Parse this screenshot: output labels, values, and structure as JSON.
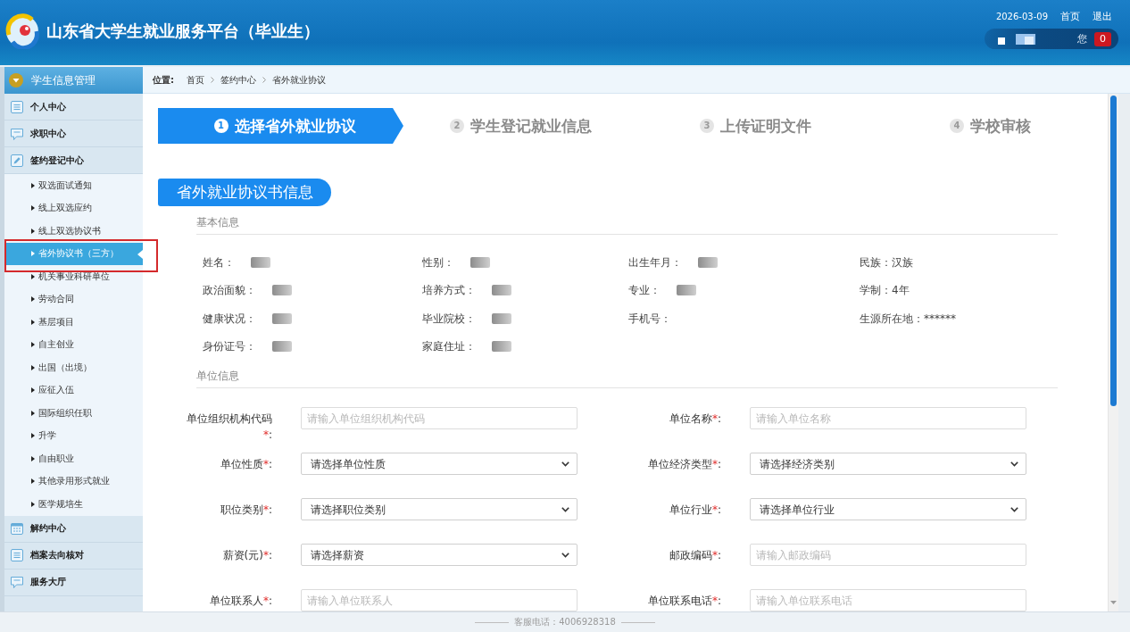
{
  "header": {
    "title": "山东省大学生就业服务平台（毕业生）",
    "date": "2026-03-09",
    "links": [
      "首页",
      "退出"
    ],
    "user": {
      "redacted": true,
      "greeting": "您",
      "count": "0"
    }
  },
  "sidebar": {
    "title": "学生信息管理",
    "sections": [
      {
        "label": "个人中心"
      },
      {
        "label": "求职中心"
      },
      {
        "label": "签约登记中心",
        "children": [
          {
            "label": "双选面试通知",
            "selected": false,
            "highlighted": false
          },
          {
            "label": "线上双选应约",
            "selected": false,
            "highlighted": false
          },
          {
            "label": "线上双选协议书",
            "selected": false,
            "highlighted": false
          },
          {
            "label": "省外协议书（三方）",
            "selected": true,
            "highlighted": true
          },
          {
            "label": "机关事业科研单位",
            "selected": false,
            "highlighted": false
          },
          {
            "label": "劳动合同",
            "selected": false,
            "highlighted": false
          },
          {
            "label": "基层项目",
            "selected": false,
            "highlighted": false
          },
          {
            "label": "自主创业",
            "selected": false,
            "highlighted": false
          },
          {
            "label": "出国（出境）",
            "selected": false,
            "highlighted": false
          },
          {
            "label": "应征入伍",
            "selected": false,
            "highlighted": false
          },
          {
            "label": "国际组织任职",
            "selected": false,
            "highlighted": false
          },
          {
            "label": "升学",
            "selected": false,
            "highlighted": false
          },
          {
            "label": "自由职业",
            "selected": false,
            "highlighted": false
          },
          {
            "label": "其他录用形式就业",
            "selected": false,
            "highlighted": false
          },
          {
            "label": "医学规培生",
            "selected": false,
            "highlighted": false
          }
        ]
      },
      {
        "label": "解约中心"
      },
      {
        "label": "档案去向核对"
      },
      {
        "label": "服务大厅"
      }
    ]
  },
  "breadcrumb": {
    "label": "位置:",
    "items": [
      "首页",
      "签约中心",
      "省外就业协议"
    ]
  },
  "steps": [
    {
      "number": "1",
      "label": "选择省外就业协议",
      "selected": true
    },
    {
      "number": "2",
      "label": "学生登记就业信息",
      "selected": false
    },
    {
      "number": "3",
      "label": "上传证明文件",
      "selected": false
    },
    {
      "number": "4",
      "label": "学校审核",
      "selected": false
    }
  ],
  "section_title": "省外就业协议书信息",
  "basic_info": {
    "title": "基本信息",
    "fields": [
      {
        "label": "姓名：",
        "redacted": true
      },
      {
        "label": "性别：",
        "redacted": true
      },
      {
        "label": "出生年月：",
        "redacted": true
      },
      {
        "label": "民族：",
        "value": "汉族",
        "redacted": false
      },
      {
        "label": "政治面貌：",
        "redacted": true
      },
      {
        "label": "培养方式：",
        "redacted": true
      },
      {
        "label": "专业：",
        "redacted": true
      },
      {
        "label": "学制：",
        "value": "4年",
        "redacted": false
      },
      {
        "label": "健康状况：",
        "redacted": true
      },
      {
        "label": "毕业院校：",
        "redacted": true
      },
      {
        "label": "手机号：",
        "redacted": false
      },
      {
        "label": "生源所在地：",
        "value": "******",
        "redacted": false
      },
      {
        "label": "身份证号：",
        "redacted": true
      },
      {
        "label": "家庭住址：",
        "redacted": true
      }
    ]
  },
  "unit_info": {
    "title": "单位信息",
    "fields": [
      {
        "kind": "input",
        "label": "单位组织机构代码",
        "required": "*",
        "colon": ":",
        "placeholder": "请输入单位组织机构代码"
      },
      {
        "kind": "input",
        "label": "单位名称",
        "required": "*",
        "colon": ":",
        "placeholder": "请输入单位名称"
      },
      {
        "kind": "select",
        "label": "单位性质",
        "required": "*",
        "colon": ":",
        "value": "请选择单位性质"
      },
      {
        "kind": "select",
        "label": "单位经济类型",
        "required": "*",
        "colon": ":",
        "value": "请选择经济类别"
      },
      {
        "kind": "select",
        "label": "职位类别",
        "required": "*",
        "colon": ":",
        "value": "请选择职位类别"
      },
      {
        "kind": "select",
        "label": "单位行业",
        "required": "*",
        "colon": ":",
        "value": "请选择单位行业"
      },
      {
        "kind": "select",
        "label": "薪资(元)",
        "required": "*",
        "colon": ":",
        "value": "请选择薪资"
      },
      {
        "kind": "input",
        "label": "邮政编码",
        "required": "*",
        "colon": ":",
        "placeholder": "请输入邮政编码"
      },
      {
        "kind": "input",
        "label": "单位联系人",
        "required": "*",
        "colon": ":",
        "placeholder": "请输入单位联系人"
      },
      {
        "kind": "input",
        "label": "单位联系电话",
        "required": "*",
        "colon": ":",
        "placeholder": "请输入单位联系电话"
      }
    ]
  },
  "footer": {
    "text": "客服电话：4006928318"
  }
}
